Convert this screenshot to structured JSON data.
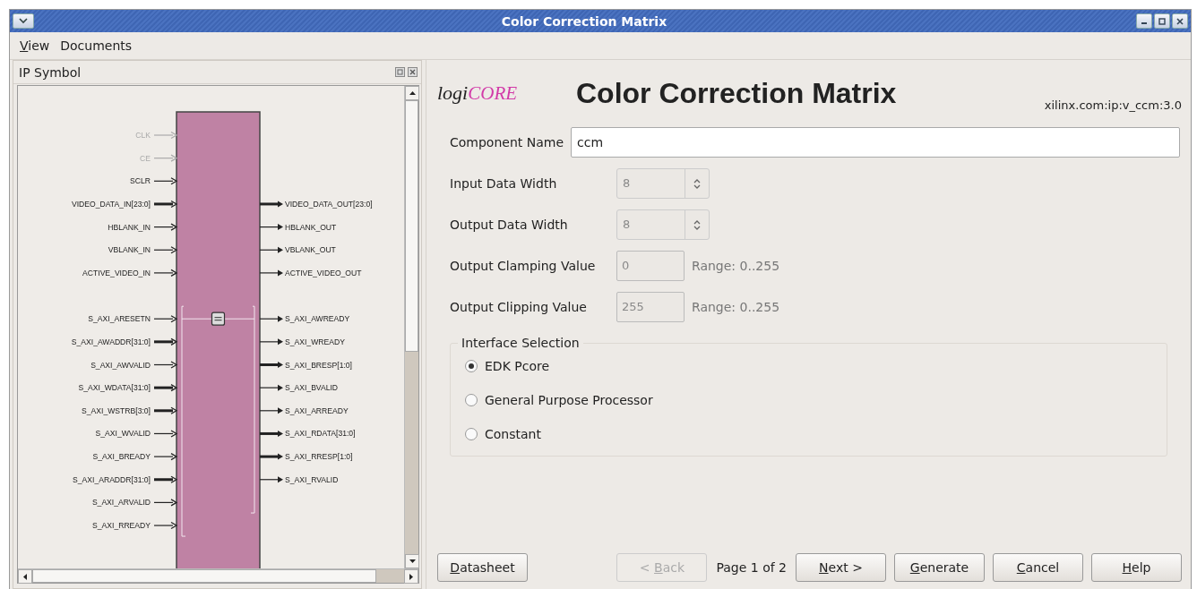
{
  "window": {
    "title": "Color Correction Matrix"
  },
  "menu": [
    {
      "label": "View",
      "mnemonic": true
    },
    {
      "label": "Documents",
      "mnemonic": false
    }
  ],
  "symbol_panel": {
    "title": "IP Symbol",
    "sections": [
      {
        "rows": [
          {
            "in": {
              "name": "CLK",
              "bus": false,
              "disabled": true
            }
          },
          {
            "in": {
              "name": "CE",
              "bus": false,
              "disabled": true
            }
          },
          {
            "in": {
              "name": "SCLR",
              "bus": false,
              "disabled": false
            }
          },
          {
            "in": {
              "name": "VIDEO_DATA_IN[23:0]",
              "bus": true,
              "disabled": false
            },
            "out": {
              "name": "VIDEO_DATA_OUT[23:0]",
              "bus": true,
              "disabled": false
            }
          },
          {
            "in": {
              "name": "HBLANK_IN",
              "bus": false,
              "disabled": false
            },
            "out": {
              "name": "HBLANK_OUT",
              "bus": false,
              "disabled": false
            }
          },
          {
            "in": {
              "name": "VBLANK_IN",
              "bus": false,
              "disabled": false
            },
            "out": {
              "name": "VBLANK_OUT",
              "bus": false,
              "disabled": false
            }
          },
          {
            "in": {
              "name": "ACTIVE_VIDEO_IN",
              "bus": false,
              "disabled": false
            },
            "out": {
              "name": "ACTIVE_VIDEO_OUT",
              "bus": false,
              "disabled": false
            }
          }
        ]
      },
      {
        "bus_interface": true,
        "rows": [
          {
            "in": {
              "name": "S_AXI_ARESETN",
              "bus": false,
              "disabled": false
            },
            "out": {
              "name": "S_AXI_AWREADY",
              "bus": false,
              "disabled": false
            }
          },
          {
            "in": {
              "name": "S_AXI_AWADDR[31:0]",
              "bus": true,
              "disabled": false
            },
            "out": {
              "name": "S_AXI_WREADY",
              "bus": false,
              "disabled": false
            }
          },
          {
            "in": {
              "name": "S_AXI_AWVALID",
              "bus": false,
              "disabled": false
            },
            "out": {
              "name": "S_AXI_BRESP[1:0]",
              "bus": true,
              "disabled": false
            }
          },
          {
            "in": {
              "name": "S_AXI_WDATA[31:0]",
              "bus": true,
              "disabled": false
            },
            "out": {
              "name": "S_AXI_BVALID",
              "bus": false,
              "disabled": false
            }
          },
          {
            "in": {
              "name": "S_AXI_WSTRB[3:0]",
              "bus": true,
              "disabled": false
            },
            "out": {
              "name": "S_AXI_ARREADY",
              "bus": false,
              "disabled": false
            }
          },
          {
            "in": {
              "name": "S_AXI_WVALID",
              "bus": false,
              "disabled": false
            },
            "out": {
              "name": "S_AXI_RDATA[31:0]",
              "bus": true,
              "disabled": false
            }
          },
          {
            "in": {
              "name": "S_AXI_BREADY",
              "bus": false,
              "disabled": false
            },
            "out": {
              "name": "S_AXI_RRESP[1:0]",
              "bus": true,
              "disabled": false
            }
          },
          {
            "in": {
              "name": "S_AXI_ARADDR[31:0]",
              "bus": true,
              "disabled": false
            },
            "out": {
              "name": "S_AXI_RVALID",
              "bus": false,
              "disabled": false
            }
          },
          {
            "in": {
              "name": "S_AXI_ARVALID",
              "bus": false,
              "disabled": false
            }
          },
          {
            "in": {
              "name": "S_AXI_RREADY",
              "bus": false,
              "disabled": false
            }
          }
        ]
      }
    ]
  },
  "header": {
    "logo": {
      "prefix": "logi",
      "suffix": "CORE"
    },
    "title": "Color Correction Matrix",
    "identifier": "xilinx.com:ip:v_ccm:3.0"
  },
  "form": [
    {
      "kind": "text",
      "label": "Component Name",
      "value": "ccm",
      "disabled": false
    },
    {
      "kind": "spinner",
      "label": "Input Data Width",
      "value": "8",
      "disabled": true
    },
    {
      "kind": "spinner",
      "label": "Output Data Width",
      "value": "8",
      "disabled": true
    },
    {
      "kind": "number",
      "label": "Output Clamping Value",
      "value": "0",
      "disabled": true,
      "hint": "Range: 0..255"
    },
    {
      "kind": "number",
      "label": "Output Clipping Value",
      "value": "255",
      "disabled": true,
      "hint": "Range: 0..255"
    }
  ],
  "interface_selection": {
    "title": "Interface Selection",
    "options": [
      {
        "label": "EDK Pcore",
        "selected": true
      },
      {
        "label": "General Purpose Processor",
        "selected": false
      },
      {
        "label": "Constant",
        "selected": false
      }
    ]
  },
  "footer": {
    "datasheet": {
      "label": "Datasheet",
      "mnemonic": true
    },
    "page": "Page 1 of 2",
    "buttons": [
      {
        "label": "< Back",
        "mnemonic": true,
        "disabled": true
      },
      {
        "label": "Next >",
        "mnemonic": true,
        "disabled": false
      },
      {
        "label": "Generate",
        "mnemonic": true,
        "disabled": false
      },
      {
        "label": "Cancel",
        "mnemonic": true,
        "disabled": false
      },
      {
        "label": "Help",
        "mnemonic": true,
        "disabled": false
      }
    ]
  }
}
